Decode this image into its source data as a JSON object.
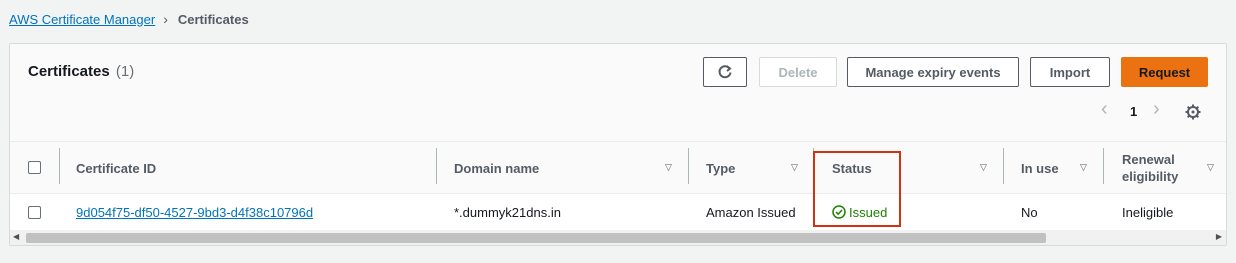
{
  "breadcrumb": {
    "parent": "AWS Certificate Manager",
    "current": "Certificates"
  },
  "panel": {
    "title": "Certificates",
    "count": "(1)",
    "buttons": {
      "delete": "Delete",
      "manage_expiry": "Manage expiry events",
      "import": "Import",
      "request": "Request"
    },
    "pagination": {
      "current_page": "1"
    }
  },
  "table": {
    "columns": [
      "Certificate ID",
      "Domain name",
      "Type",
      "Status",
      "In use",
      "Renewal",
      "eligibility"
    ],
    "rows": [
      {
        "certificate_id": "9d054f75-df50-4527-9bd3-d4f38c10796d",
        "domain_name": "*.dummyk21dns.in",
        "type": "Amazon Issued",
        "status": "Issued",
        "in_use": "No",
        "renewal_eligibility": "Ineligible"
      }
    ]
  },
  "colors": {
    "link": "#0073bb",
    "primary": "#ec7211",
    "success": "#1d8102",
    "highlight": "#d13212"
  }
}
